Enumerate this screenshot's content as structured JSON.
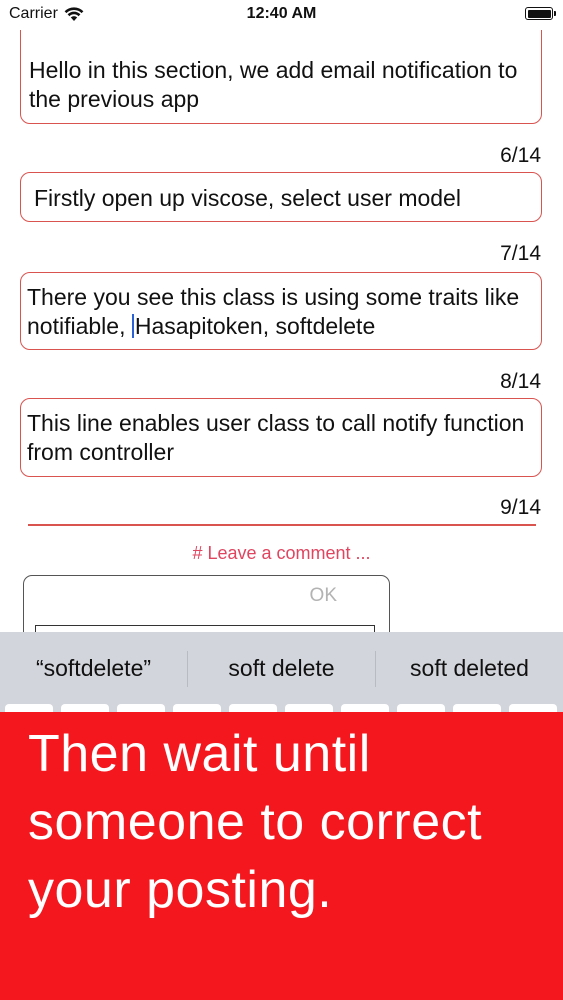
{
  "status_bar": {
    "carrier": "Carrier",
    "time": "12:40 AM"
  },
  "messages": [
    {
      "text": "Hello in this section, we add email notification to the previous app",
      "counter": "6/14"
    },
    {
      "text": "Firstly open up viscose, select user model",
      "counter": "7/14"
    },
    {
      "text_before_caret": " There you see this class is using some traits like notifiable, ",
      "text_after_caret": "Hasapitoken, softdelete",
      "counter": "8/14"
    },
    {
      "text": " This line enables user class to call notify function from controller",
      "counter": "9/14"
    }
  ],
  "comment": {
    "leave_comment_label": "# Leave a comment ...",
    "ok_label": "OK",
    "input_value": ""
  },
  "keyboard": {
    "suggestions": [
      "“softdelete”",
      "soft delete",
      "soft deleted"
    ]
  },
  "overlay": {
    "text": "Then wait until someone to correct your posting."
  },
  "colors": {
    "bubble_border": "#d9534f",
    "accent_pink": "#e0445f",
    "overlay_red": "#f5171e",
    "keyboard_bg": "#d2d5db"
  }
}
